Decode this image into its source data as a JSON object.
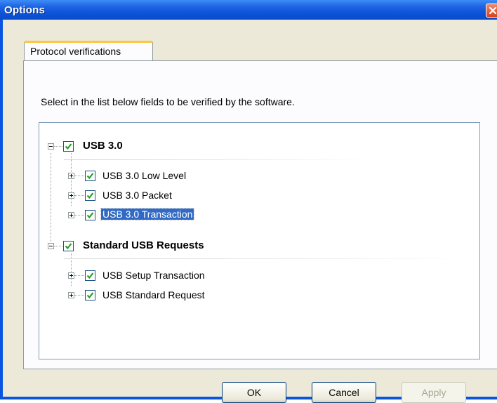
{
  "window": {
    "title": "Options"
  },
  "tabs": [
    {
      "label": "Protocol verifications"
    }
  ],
  "panel": {
    "instruction": "Select in the list below fields to be verified by the software."
  },
  "tree": {
    "groups": [
      {
        "label": "USB 3.0",
        "checked": true,
        "expanded": true,
        "children": [
          {
            "label": "USB 3.0 Low Level",
            "checked": true
          },
          {
            "label": "USB 3.0 Packet",
            "checked": true
          },
          {
            "label": "USB 3.0 Transaction",
            "checked": true,
            "selected": true
          }
        ]
      },
      {
        "label": "Standard USB Requests",
        "checked": true,
        "expanded": true,
        "children": [
          {
            "label": "USB Setup Transaction",
            "checked": true
          },
          {
            "label": "USB Standard Request",
            "checked": true
          }
        ]
      }
    ]
  },
  "buttons": {
    "ok": "OK",
    "cancel": "Cancel",
    "apply": "Apply"
  },
  "icons": {
    "close": "close-icon",
    "check": "checkmark-icon",
    "expand": "expand-plus-icon",
    "collapse": "collapse-minus-icon"
  },
  "colors": {
    "titlebar": "#0a55e0",
    "dialog_bg": "#ece9d8",
    "selection": "#316ac5",
    "tab_highlight": "#ffc83c",
    "check_green": "#21a121"
  }
}
